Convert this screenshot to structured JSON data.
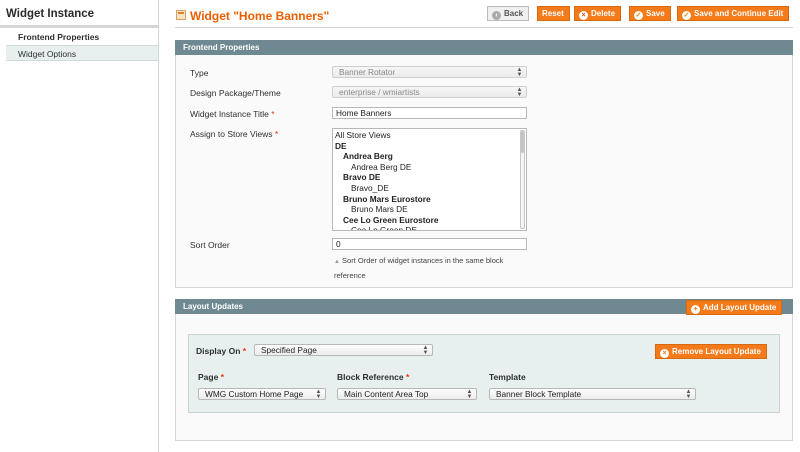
{
  "sidebar": {
    "title": "Widget Instance",
    "items": [
      {
        "label": "Frontend Properties",
        "active": true
      },
      {
        "label": "Widget Options",
        "active": false
      }
    ]
  },
  "header": {
    "title": "Widget \"Home Banners\"",
    "buttons": {
      "back": "Back",
      "reset": "Reset",
      "delete": "Delete",
      "save": "Save",
      "save_continue": "Save and Continue Edit"
    }
  },
  "frontend": {
    "section_title": "Frontend Properties",
    "type": {
      "label": "Type",
      "value": "Banner Rotator"
    },
    "design": {
      "label": "Design Package/Theme",
      "value": "enterprise / wmiartists"
    },
    "title_field": {
      "label": "Widget Instance Title",
      "value": "Home Banners"
    },
    "store_views": {
      "label": "Assign to Store Views",
      "options": [
        {
          "text": "All Store Views",
          "level": 0,
          "bold": false
        },
        {
          "text": "DE",
          "level": 0,
          "bold": true
        },
        {
          "text": "Andrea Berg",
          "level": 1,
          "bold": true
        },
        {
          "text": "Andrea Berg DE",
          "level": 2,
          "bold": false
        },
        {
          "text": "Bravo DE",
          "level": 1,
          "bold": true
        },
        {
          "text": "Bravo_DE",
          "level": 2,
          "bold": false
        },
        {
          "text": "Bruno Mars Eurostore",
          "level": 1,
          "bold": true
        },
        {
          "text": "Bruno Mars DE",
          "level": 2,
          "bold": false
        },
        {
          "text": "Cee Lo Green Eurostore",
          "level": 1,
          "bold": true
        },
        {
          "text": "Cee Lo Green DE",
          "level": 2,
          "bold": false
        }
      ]
    },
    "sort_order": {
      "label": "Sort Order",
      "value": "0",
      "note": "Sort Order of widget instances in the same block reference"
    }
  },
  "layout": {
    "section_title": "Layout Updates",
    "add_button": "Add Layout Update",
    "remove_button": "Remove Layout Update",
    "display_on": {
      "label": "Display On",
      "value": "Specified Page"
    },
    "page": {
      "label": "Page",
      "value": "WMG Custom Home Page"
    },
    "block": {
      "label": "Block Reference",
      "value": "Main Content Area Top"
    },
    "template": {
      "label": "Template",
      "value": "Banner Block Template"
    }
  },
  "colors": {
    "accent": "#eb5e00",
    "button": "#f47a1a",
    "section_header": "#6f8992",
    "inner_panel": "#e7efef"
  }
}
